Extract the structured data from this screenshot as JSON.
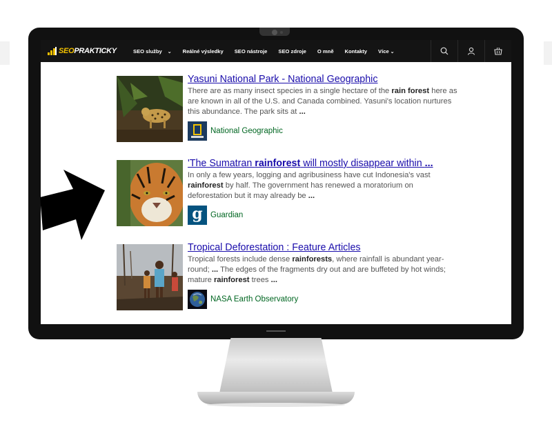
{
  "nav": {
    "logo_text": "SEOPRAKTICKY",
    "items": [
      "SEO služby",
      "Reálné výsledky",
      "SEO nástroje",
      "SEO zdroje",
      "O mně",
      "Kontakty",
      "Více"
    ],
    "icons": [
      "search-icon",
      "user-icon",
      "basket-icon"
    ]
  },
  "results": [
    {
      "title": "Yasuni National Park - National Geographic",
      "snippet_parts": [
        {
          "t": "There are as many insect species in a single hectare of the ",
          "b": false
        },
        {
          "t": "rain forest",
          "b": true
        },
        {
          "t": " here as are known in all of the U.S. and Canada combined. Yasuni's location nurtures this abundance. The park sits at ",
          "b": false
        },
        {
          "t": "...",
          "b": true
        }
      ],
      "source": "National Geographic"
    },
    {
      "title_parts": [
        {
          "t": "'The Sumatran ",
          "b": false
        },
        {
          "t": "rainforest",
          "b": true
        },
        {
          "t": " will mostly disappear within ",
          "b": false
        },
        {
          "t": "...",
          "b": true
        }
      ],
      "snippet_parts": [
        {
          "t": "In only a few years, logging and agribusiness have cut Indonesia's vast ",
          "b": false
        },
        {
          "t": "rainforest",
          "b": true
        },
        {
          "t": " by half. The government has renewed a moratorium on deforestation but it may already be ",
          "b": false
        },
        {
          "t": "...",
          "b": true
        }
      ],
      "source": "Guardian",
      "source_icon_letter": "g"
    },
    {
      "title": "Tropical Deforestation : Feature Articles",
      "snippet_parts": [
        {
          "t": "Tropical forests include dense ",
          "b": false
        },
        {
          "t": "rainforests",
          "b": true
        },
        {
          "t": ", where rainfall is abundant year-round; ",
          "b": false
        },
        {
          "t": "...",
          "b": true
        },
        {
          "t": " The edges of the fragments dry out and are buffeted by hot winds; mature ",
          "b": false
        },
        {
          "t": "rainforest",
          "b": true
        },
        {
          "t": " trees ",
          "b": false
        },
        {
          "t": "...",
          "b": true
        }
      ],
      "source": "NASA Earth Observatory"
    }
  ],
  "colors": {
    "link": "#1a0dab",
    "source": "#006621",
    "snippet": "#545454",
    "accent": "#f2c100"
  }
}
